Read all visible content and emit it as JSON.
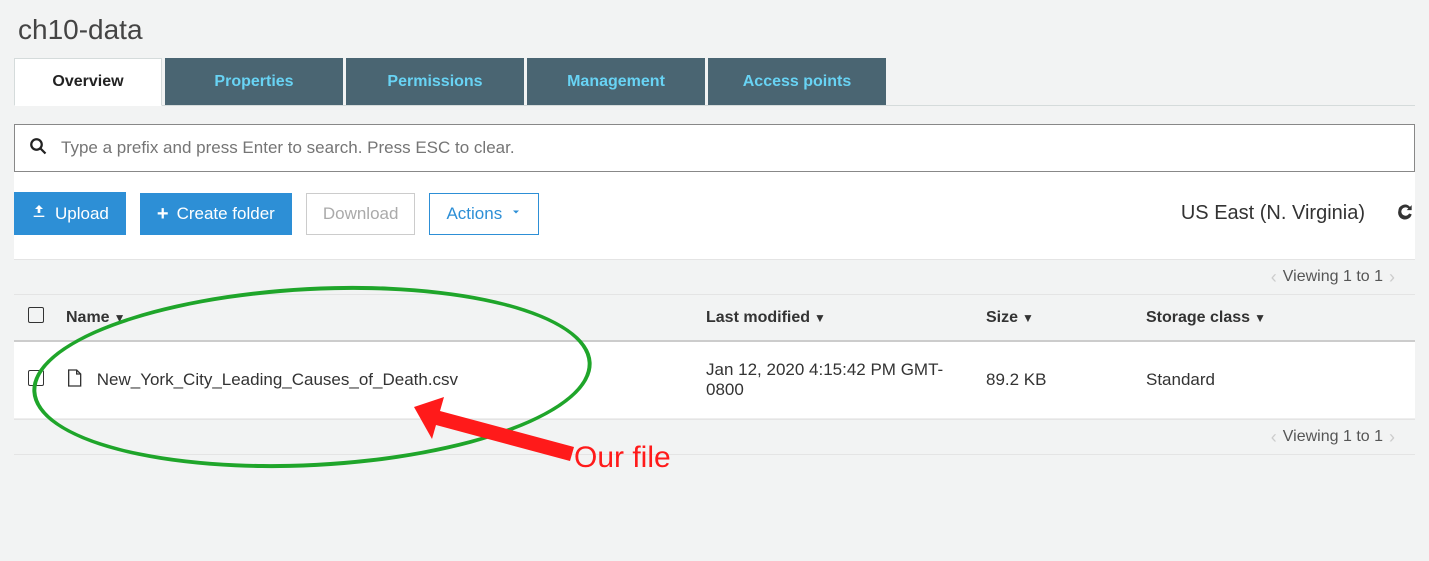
{
  "bucket_title": "ch10-data",
  "tabs": {
    "overview": "Overview",
    "properties": "Properties",
    "permissions": "Permissions",
    "management": "Management",
    "access_points": "Access points"
  },
  "search": {
    "placeholder": "Type a prefix and press Enter to search. Press ESC to clear."
  },
  "toolbar": {
    "upload": "Upload",
    "create_folder": "Create folder",
    "download": "Download",
    "actions": "Actions",
    "region": "US East (N. Virginia)"
  },
  "pager": {
    "text": "Viewing 1 to 1"
  },
  "columns": {
    "name": "Name",
    "last_modified": "Last modified",
    "size": "Size",
    "storage_class": "Storage class"
  },
  "rows": [
    {
      "name": "New_York_City_Leading_Causes_of_Death.csv",
      "last_modified": "Jan 12, 2020 4:15:42 PM GMT-0800",
      "size": "89.2 KB",
      "storage_class": "Standard"
    }
  ],
  "annotation": {
    "label": "Our file"
  }
}
